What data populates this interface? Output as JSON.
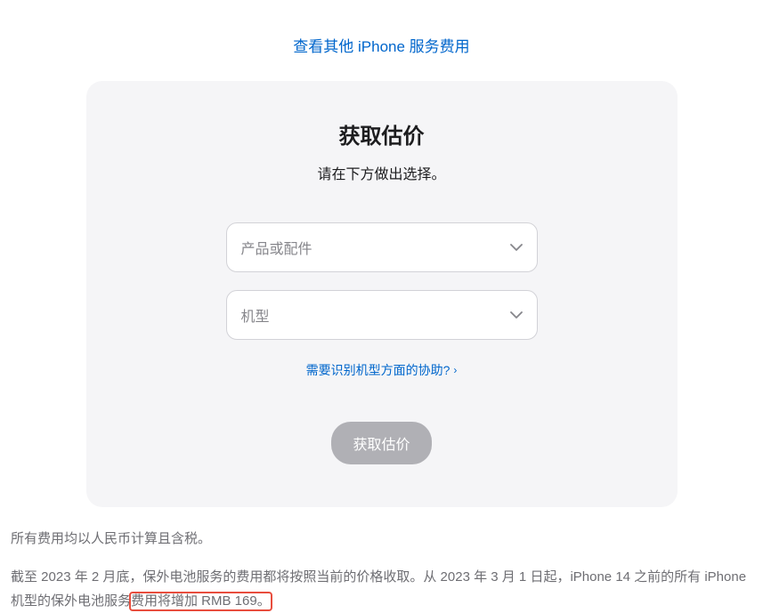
{
  "topLink": {
    "label": "查看其他 iPhone 服务费用"
  },
  "card": {
    "title": "获取估价",
    "subtitle": "请在下方做出选择。",
    "select1": {
      "placeholder": "产品或配件"
    },
    "select2": {
      "placeholder": "机型"
    },
    "helpLink": {
      "label": "需要识别机型方面的协助?"
    },
    "submitButton": {
      "label": "获取估价"
    }
  },
  "footer": {
    "line1": "所有费用均以人民币计算且含税。",
    "line2_part1": "截至 2023 年 2 月底，保外电池服务的费用都将按照当前的价格收取。从 2023 年 3 月 1 日起，iPhone 14 之前的所有 iPhone 机型的保外电池服务",
    "line2_highlight": "费用将增加 RMB 169。"
  }
}
